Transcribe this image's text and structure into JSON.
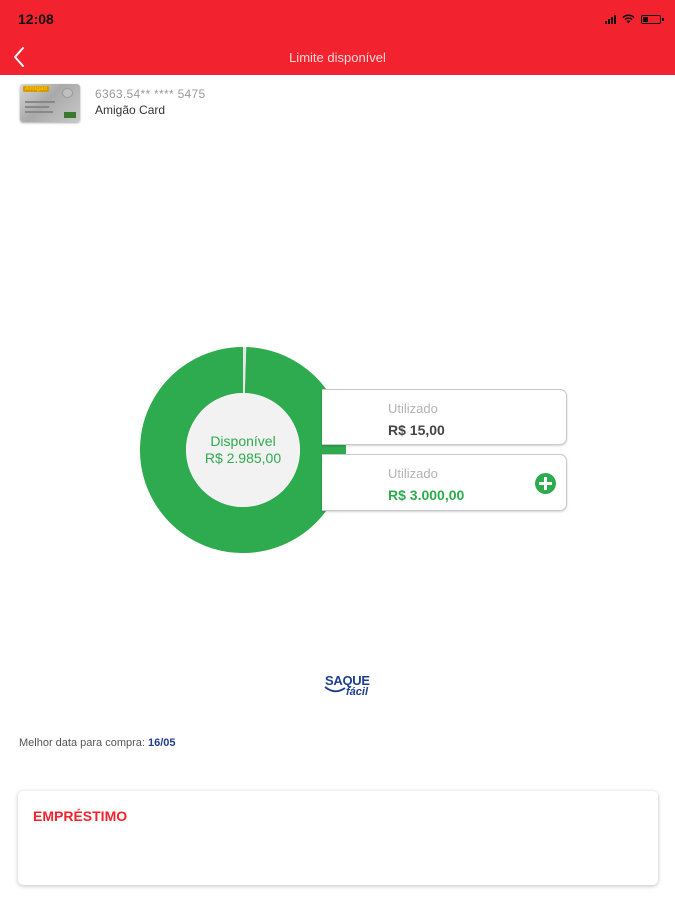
{
  "status_bar": {
    "time": "12:08"
  },
  "header": {
    "title": "Limite disponível"
  },
  "card": {
    "number": "6363.54** **** 5475",
    "name": "Amigão Card",
    "brand": "Amigão"
  },
  "limit": {
    "center_label": "Disponível",
    "center_value": "R$ 2.985,00",
    "used_label": "Utilizado",
    "used_value": "R$ 15,00",
    "total_label": "Utilizado",
    "total_value": "R$ 3.000,00",
    "available_amount": 2985,
    "used_amount": 15,
    "total_amount": 3000
  },
  "saque": {
    "line1": "SAQUE",
    "line2": "fácil"
  },
  "best_date": {
    "label": "Melhor data para compra:",
    "value": "16/05"
  },
  "loan": {
    "title": "EMPRÉSTIMO"
  },
  "colors": {
    "brand_red": "#f2232e",
    "green": "#2eab4f",
    "navy": "#1e3f8f"
  }
}
